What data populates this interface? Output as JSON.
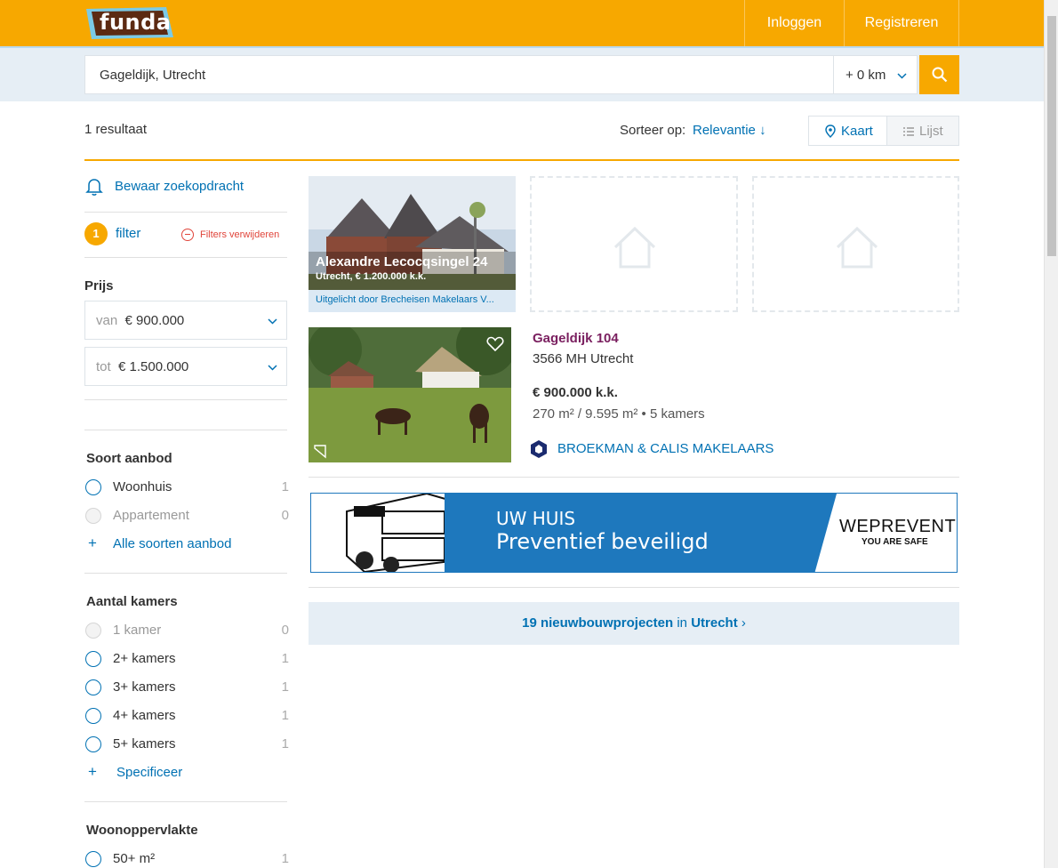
{
  "header": {
    "logo": "funda",
    "login": "Inloggen",
    "register": "Registreren"
  },
  "search": {
    "location": "Gageldijk, Utrecht",
    "radius": "+ 0 km"
  },
  "results": {
    "count": "1 resultaat",
    "sort_label": "Sorteer op:",
    "sort_value": "Relevantie",
    "sort_arrow": "↓",
    "view_map": "Kaart",
    "view_list": "Lijst"
  },
  "sidebar": {
    "save_search": "Bewaar zoekopdracht",
    "filter_count": "1",
    "filter_label": "filter",
    "remove_filters": "Filters verwijderen",
    "price_heading": "Prijs",
    "price_from_prefix": "van",
    "price_from": "€ 900.000",
    "price_to_prefix": "tot",
    "price_to": "€ 1.500.000",
    "type_heading": "Soort aanbod",
    "types": [
      {
        "label": "Woonhuis",
        "count": "1"
      },
      {
        "label": "Appartement",
        "count": "0"
      }
    ],
    "types_more": "Alle soorten aanbod",
    "rooms_heading": "Aantal kamers",
    "rooms": [
      {
        "label": "1 kamer",
        "count": "0"
      },
      {
        "label": "2+ kamers",
        "count": "1"
      },
      {
        "label": "3+ kamers",
        "count": "1"
      },
      {
        "label": "4+ kamers",
        "count": "1"
      },
      {
        "label": "5+ kamers",
        "count": "1"
      }
    ],
    "rooms_more": "Specificeer",
    "area_heading": "Woonoppervlakte",
    "area": [
      {
        "label": "50+ m²",
        "count": "1"
      }
    ]
  },
  "featured": {
    "title": "Alexandre Lecocqsingel 24",
    "subtitle": "Utrecht, € 1.200.000 k.k.",
    "promo": "Uitgelicht door Brecheisen Makelaars V..."
  },
  "listing": {
    "address": "Gageldijk 104",
    "postal": "3566 MH Utrecht",
    "price": "€ 900.000 k.k.",
    "specs": "270 m² / 9.595 m² • 5 kamers",
    "agent": "BROEKMAN & CALIS MAKELAARS"
  },
  "ad": {
    "line1": "UW HUIS",
    "line2": "Preventief beveiligd",
    "brand": "WEPREVENT",
    "tagline": "YOU ARE SAFE"
  },
  "nieuwbouw": {
    "count_text": "19 nieuwbouwprojecten",
    "in": "in",
    "city": "Utrecht",
    "arrow": "›"
  }
}
